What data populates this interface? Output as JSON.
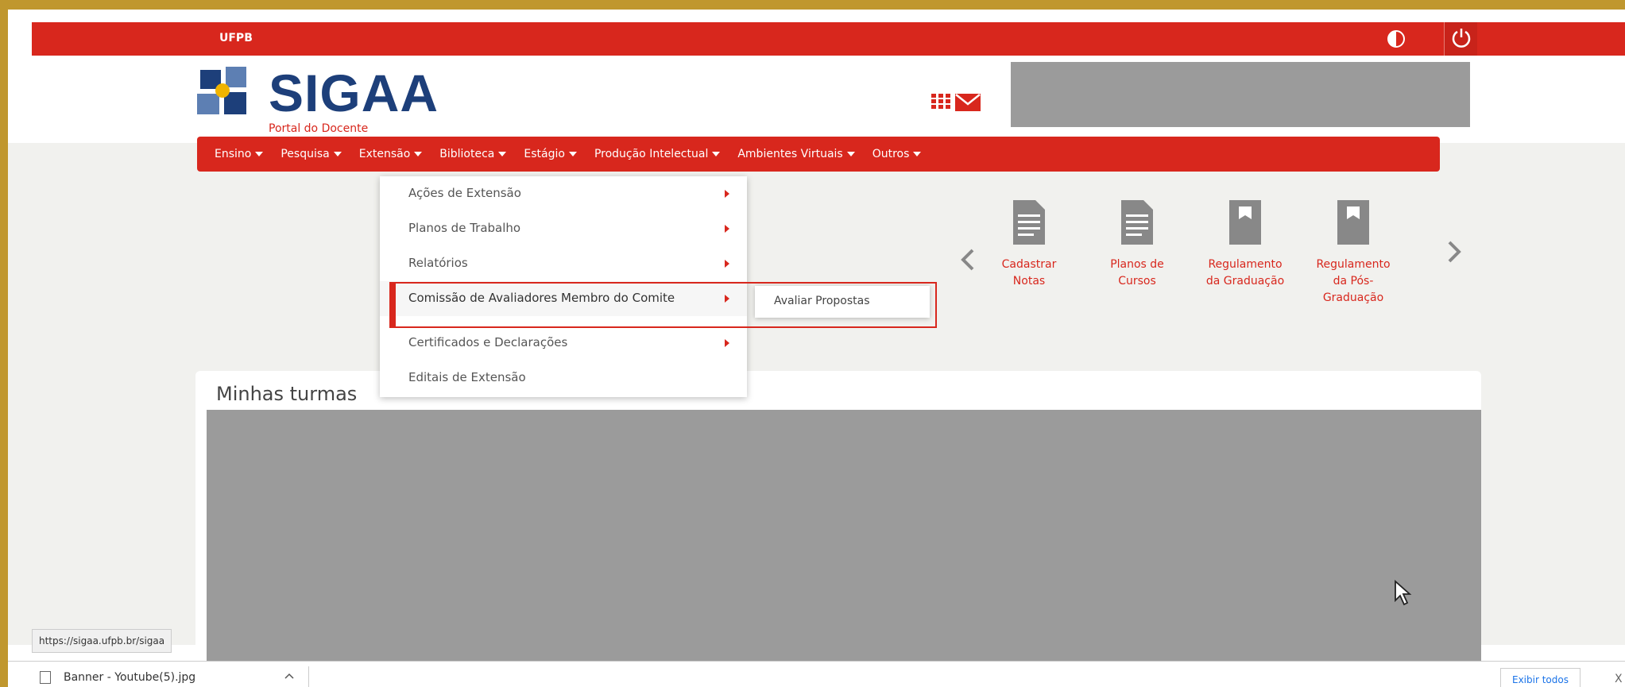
{
  "topbar": {
    "institution": "UFPB"
  },
  "header": {
    "app_name": "SIGAA",
    "portal_name": "Portal do Docente"
  },
  "nav": {
    "items": [
      {
        "label": "Ensino"
      },
      {
        "label": "Pesquisa"
      },
      {
        "label": "Extensão"
      },
      {
        "label": "Biblioteca"
      },
      {
        "label": "Estágio"
      },
      {
        "label": "Produção Intelectual"
      },
      {
        "label": "Ambientes Virtuais"
      },
      {
        "label": "Outros"
      }
    ]
  },
  "dropdown": {
    "items": [
      {
        "label": "Ações de Extensão"
      },
      {
        "label": "Planos de Trabalho"
      },
      {
        "label": "Relatórios"
      },
      {
        "label": "Comissão de Avaliadores Membro do Comite"
      },
      {
        "label": "Certificados e Declarações"
      },
      {
        "label": "Editais de Extensão"
      }
    ],
    "submenu_item": "Avaliar Propostas"
  },
  "quick_links": [
    {
      "label_line1": "Cadastrar",
      "label_line2": "Notas",
      "label_line3": "",
      "icon": "document-icon"
    },
    {
      "label_line1": "Planos de",
      "label_line2": "Cursos",
      "label_line3": "",
      "icon": "document-icon"
    },
    {
      "label_line1": "Regulamento",
      "label_line2": "da Graduação",
      "label_line3": "",
      "icon": "book-icon"
    },
    {
      "label_line1": "Regulamento",
      "label_line2": "da Pós-",
      "label_line3": "Graduação",
      "icon": "book-icon"
    }
  ],
  "main": {
    "turmas_title": "Minhas turmas"
  },
  "status": {
    "url": "https://sigaa.ufpb.br/sigaa"
  },
  "downloads": {
    "file_name": "Banner - Youtube(5).jpg",
    "show_all": "Exibir todos",
    "close": "X"
  },
  "colors": {
    "brand_red": "#d8271d",
    "logo_blue": "#1d3f7a",
    "frame": "#c0972e"
  }
}
